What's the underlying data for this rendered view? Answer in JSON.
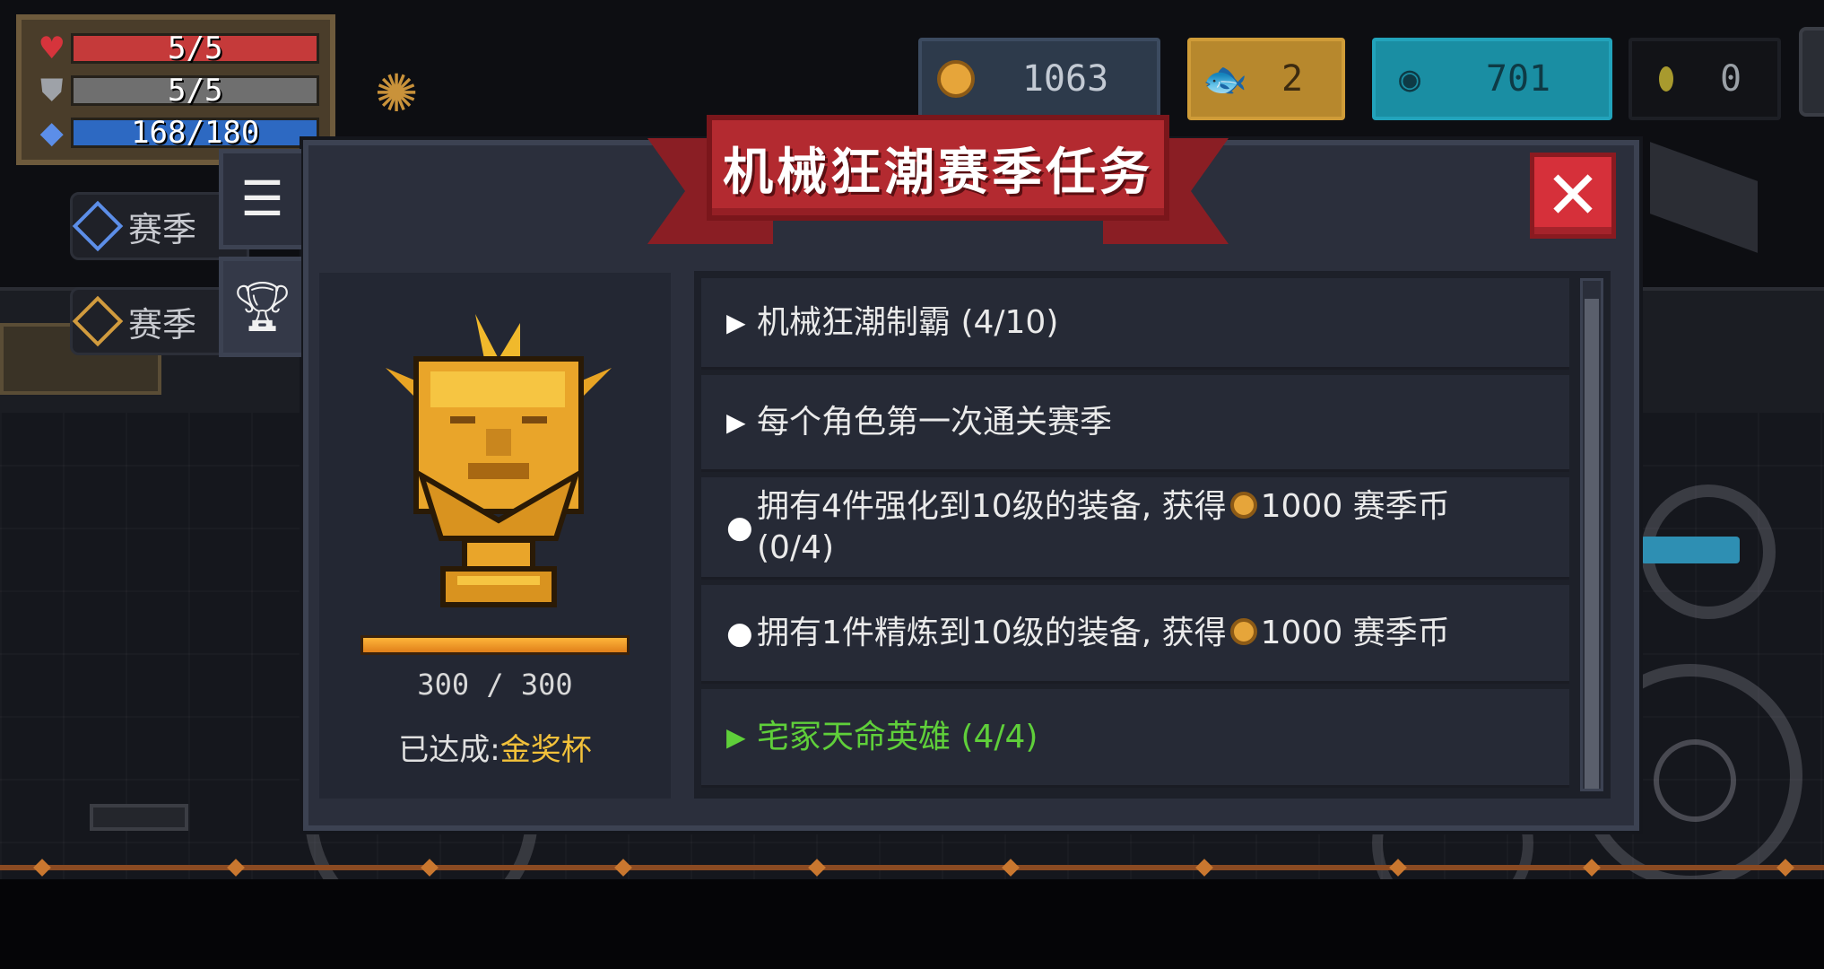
{
  "hud": {
    "hp": "5/5",
    "armor": "5/5",
    "energy": "168/180",
    "side_buttons": [
      "赛季",
      "赛季"
    ]
  },
  "currencies": {
    "coins": "1063",
    "fish": "2",
    "gems": "701",
    "seeds": "0"
  },
  "icons": {
    "hp": "heart-icon",
    "armor": "shield-icon",
    "energy": "energy-gem-icon",
    "buff": "buff-gear-icon",
    "tab_list": "list-icon",
    "tab_trophy": "trophy-icon",
    "close": "close-icon"
  },
  "dialog": {
    "title": "机械狂潮赛季任务",
    "close_label": "✕",
    "trophy": {
      "progress_current": 300,
      "progress_max": 300,
      "progress_text": "300 / 300",
      "achieved_label": "已达成:",
      "achieved_value": "金奖杯"
    },
    "missions": [
      {
        "marker": "▶",
        "text": "机械狂潮制霸 (4/10)",
        "status": "expandable"
      },
      {
        "marker": "▶",
        "text": "每个角色第一次通关赛季",
        "status": "expandable"
      },
      {
        "marker": "●",
        "text_before": "拥有4件强化到10级的装备, 获得",
        "text_after": "1000 赛季币",
        "progress": "(0/4)",
        "status": "in-progress"
      },
      {
        "marker": "●",
        "text_before": "拥有1件精炼到10级的装备, 获得",
        "text_after": "1000 赛季币",
        "status": "in-progress"
      },
      {
        "marker": "▶",
        "text": "宅冢天命英雄 (4/4)",
        "status": "completed"
      }
    ]
  },
  "colors": {
    "banner_red": "#b32a30",
    "completed_green": "#5fcf3a",
    "gold_text": "#f2c13a",
    "dialog_bg": "#2b2f3c"
  }
}
